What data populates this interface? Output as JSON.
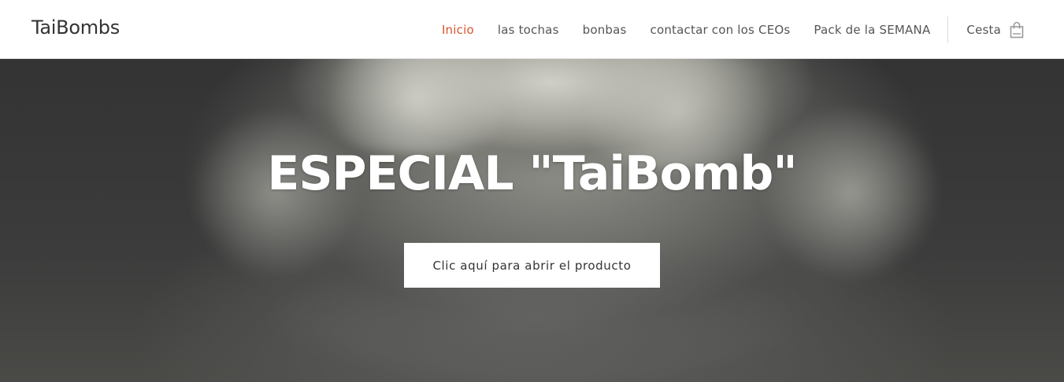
{
  "site": {
    "logo": "TaiBombs"
  },
  "nav": {
    "items": [
      {
        "label": "Inicio",
        "active": true
      },
      {
        "label": "las tochas",
        "active": false
      },
      {
        "label": "bonbas",
        "active": false
      },
      {
        "label": "contactar con los CEOs",
        "active": false
      },
      {
        "label": "Pack de la SEMANA",
        "active": false
      }
    ],
    "cart_label": "Cesta",
    "cart_icon": "shopping-bag-icon"
  },
  "hero": {
    "title": "ESPECIAL \"TaiBomb\"",
    "cta_label": "Clic aquí para abrir el producto",
    "background_image": "mushroom-cloud-photo"
  },
  "colors": {
    "accent": "#d9542f",
    "nav_text": "#555555",
    "logo_text": "#333333",
    "header_bg": "#ffffff",
    "hero_title": "#ffffff"
  }
}
